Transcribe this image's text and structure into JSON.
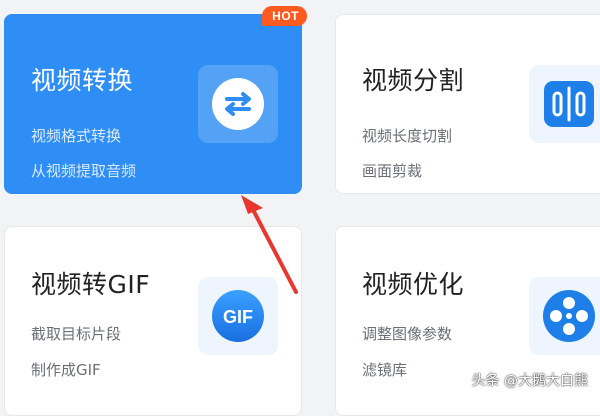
{
  "badge": {
    "hot": "HOT"
  },
  "cards": [
    {
      "title": "视频转换",
      "line1": "视频格式转换",
      "line2": "从视频提取音频",
      "icon": "convert-arrows-icon"
    },
    {
      "title": "视频分割",
      "line1": "视频长度切割",
      "line2": "画面剪裁",
      "icon": "split-icon"
    },
    {
      "title": "视频转GIF",
      "line1": "截取目标片段",
      "line2": "制作成GIF",
      "icon": "gif-icon",
      "icon_text": "GIF"
    },
    {
      "title": "视频优化",
      "line1": "调整图像参数",
      "line2": "滤镜库",
      "icon": "film-reel-icon"
    }
  ],
  "watermark": "头条 @大鹅大白熊",
  "colors": {
    "active_card": "#2f8ef5",
    "hot_badge": "#ff5a1f",
    "annotation_arrow": "#e8372e",
    "icon_blue": "#1f7fe8"
  }
}
